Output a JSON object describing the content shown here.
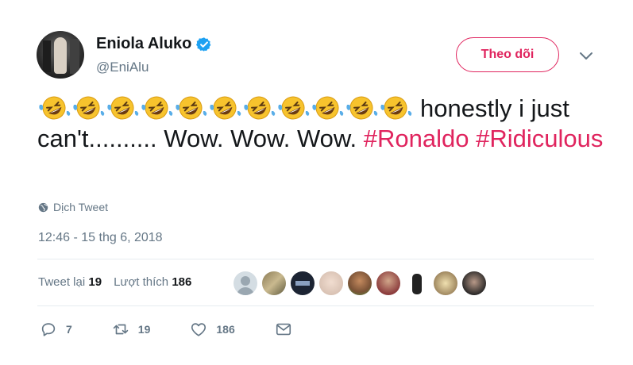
{
  "user": {
    "name": "Eniola Aluko",
    "handle": "@EniAlu"
  },
  "follow_label": "Theo dõi",
  "tweet": {
    "emoji_count": 11,
    "text_part1": "honestly i just can't.......... Wow. Wow. Wow.",
    "hashtag1": "#Ronaldo",
    "hashtag2": "#Ridiculous"
  },
  "translate_label": "Dịch Tweet",
  "timestamp": "12:46 - 15 thg 6, 2018",
  "stats": {
    "retweets_label": "Tweet lại",
    "retweets": "19",
    "likes_label": "Lượt thích",
    "likes": "186"
  },
  "actions": {
    "replies": "7",
    "retweets": "19",
    "likes": "186"
  },
  "colors": {
    "accent": "#e0245e",
    "muted": "#657786",
    "verified": "#1da1f2"
  },
  "icons": [
    "verified-badge-icon",
    "chevron-down-icon",
    "globe-icon",
    "reply-icon",
    "retweet-icon",
    "like-icon",
    "message-icon"
  ]
}
